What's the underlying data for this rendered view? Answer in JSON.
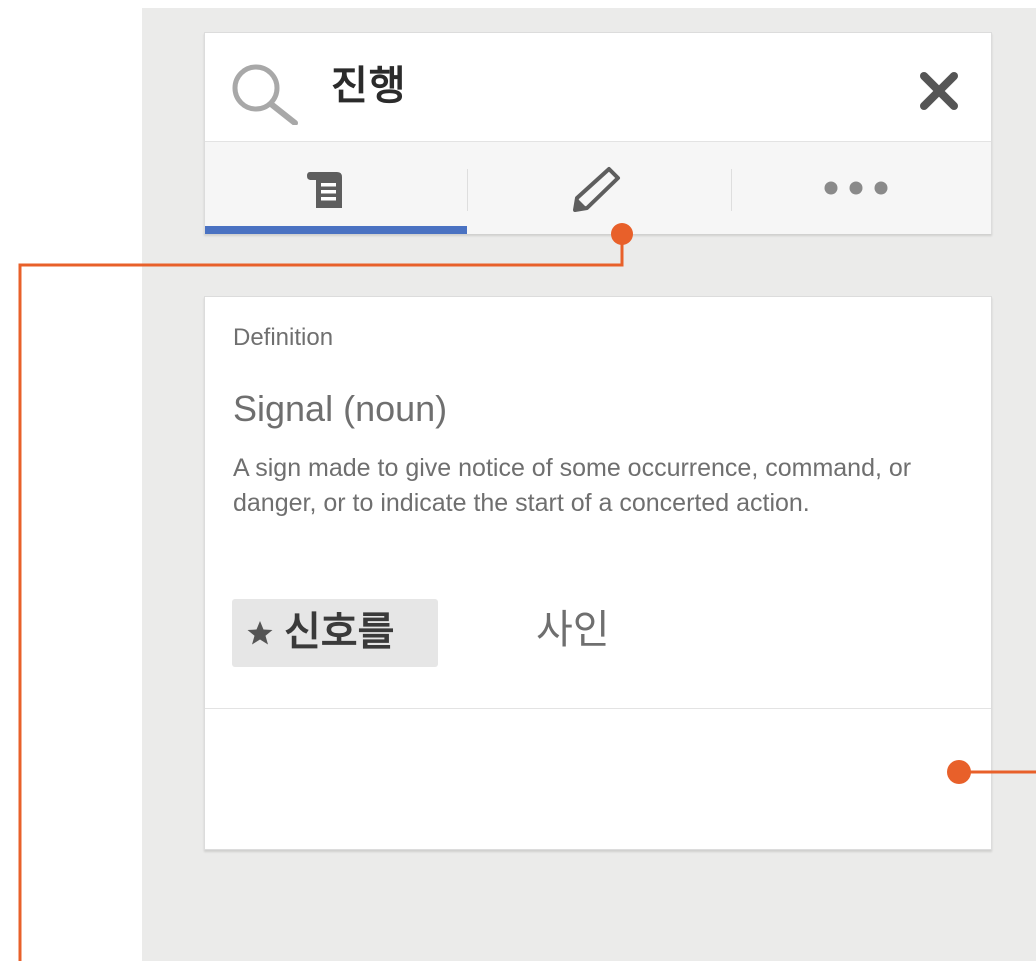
{
  "search": {
    "query": "진행",
    "search_icon": "search-icon",
    "close_icon": "close-icon"
  },
  "tabs": [
    {
      "name": "definition",
      "icon": "scroll-doc-icon",
      "active": true
    },
    {
      "name": "edit",
      "icon": "pencil-icon",
      "active": false
    },
    {
      "name": "more",
      "icon": "more-dots-icon",
      "active": false
    }
  ],
  "definition": {
    "label": "Definition",
    "term": "Signal (noun)",
    "text": "A sign made to give notice of some occurrence, command, or danger, or to indicate the start of a concerted action.",
    "primary_translation": "신호를",
    "primary_icon": "star-icon",
    "alt_translation": "사인"
  },
  "colors": {
    "accent": "#4a72c2",
    "callout": "#e8602a",
    "panel_bg": "#ebebea",
    "text_gray": "#6f6f6f"
  }
}
